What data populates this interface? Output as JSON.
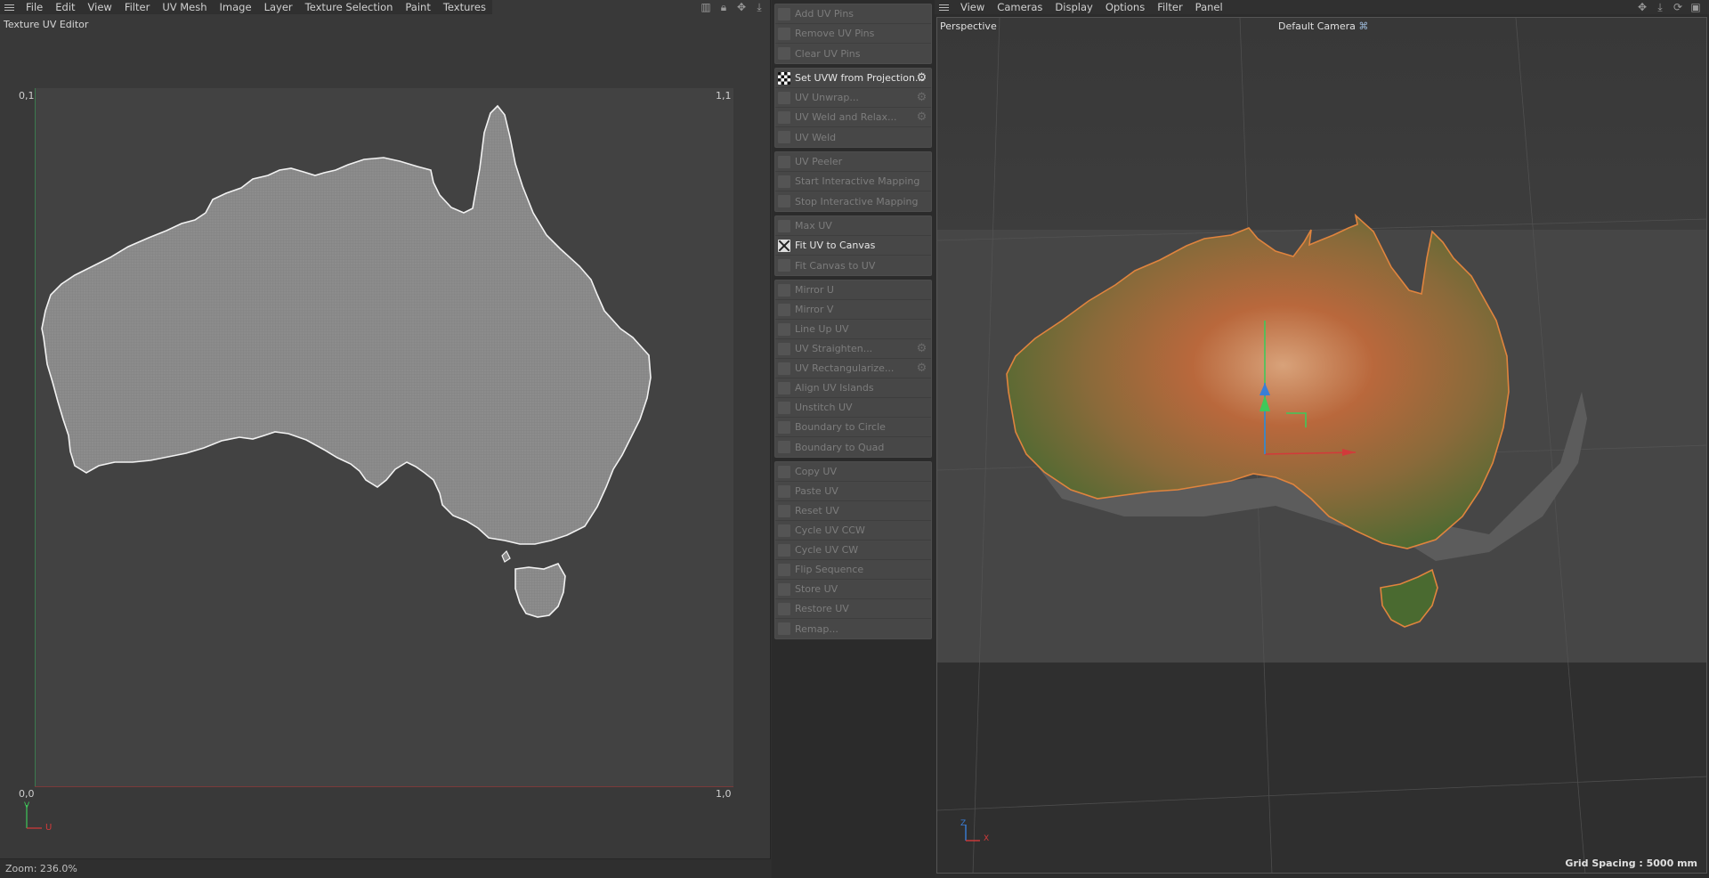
{
  "uv_editor": {
    "menu": [
      "File",
      "Edit",
      "View",
      "Filter",
      "UV Mesh",
      "Image",
      "Layer",
      "Texture Selection",
      "Paint",
      "Textures"
    ],
    "title": "Texture UV Editor",
    "coords": {
      "top_left": "0,1",
      "top_right": "1,1",
      "bottom_left": "0,0",
      "bottom_right": "1,0"
    },
    "axis_v": "V",
    "axis_u": "U",
    "zoom": "Zoom: 236.0%"
  },
  "palette": {
    "groups": [
      [
        {
          "label": "Add UV Pins",
          "active": false
        },
        {
          "label": "Remove UV Pins",
          "active": false
        },
        {
          "label": "Clear UV Pins",
          "active": false
        }
      ],
      [
        {
          "label": "Set UVW from Projection...",
          "active": true,
          "gear": true
        },
        {
          "label": "UV Unwrap...",
          "active": false,
          "gear": true
        },
        {
          "label": "UV Weld and Relax...",
          "active": false,
          "gear": true
        },
        {
          "label": "UV Weld",
          "active": false
        }
      ],
      [
        {
          "label": "UV Peeler",
          "active": false
        },
        {
          "label": "Start Interactive Mapping",
          "active": false
        },
        {
          "label": "Stop Interactive Mapping",
          "active": false
        }
      ],
      [
        {
          "label": "Max UV",
          "active": false
        },
        {
          "label": "Fit UV to Canvas",
          "active": true
        },
        {
          "label": "Fit Canvas to UV",
          "active": false
        }
      ],
      [
        {
          "label": "Mirror U",
          "active": false
        },
        {
          "label": "Mirror V",
          "active": false
        },
        {
          "label": "Line Up UV",
          "active": false
        },
        {
          "label": "UV Straighten...",
          "active": false,
          "gear": true
        },
        {
          "label": "UV Rectangularize...",
          "active": false,
          "gear": true
        },
        {
          "label": "Align UV Islands",
          "active": false
        },
        {
          "label": "Unstitch UV",
          "active": false
        },
        {
          "label": "Boundary to Circle",
          "active": false
        },
        {
          "label": "Boundary to Quad",
          "active": false
        }
      ],
      [
        {
          "label": "Copy UV",
          "active": false
        },
        {
          "label": "Paste UV",
          "active": false
        },
        {
          "label": "Reset UV",
          "active": false
        },
        {
          "label": "Cycle UV CCW",
          "active": false
        },
        {
          "label": "Cycle UV CW",
          "active": false
        },
        {
          "label": "Flip Sequence",
          "active": false
        },
        {
          "label": "Store UV",
          "active": false
        },
        {
          "label": "Restore UV",
          "active": false
        },
        {
          "label": "Remap...",
          "active": false
        }
      ]
    ]
  },
  "viewport": {
    "menu": [
      "View",
      "Cameras",
      "Display",
      "Options",
      "Filter",
      "Panel"
    ],
    "view_name": "Perspective",
    "camera": "Default Camera",
    "axis_z": "Z",
    "axis_x": "X",
    "grid_spacing": "Grid Spacing : 5000 mm"
  },
  "colors": {
    "selection_outline": "#e0843e",
    "axis_x": "#d23a3a",
    "axis_y": "#3fc85a",
    "axis_z": "#3a7ed8"
  }
}
